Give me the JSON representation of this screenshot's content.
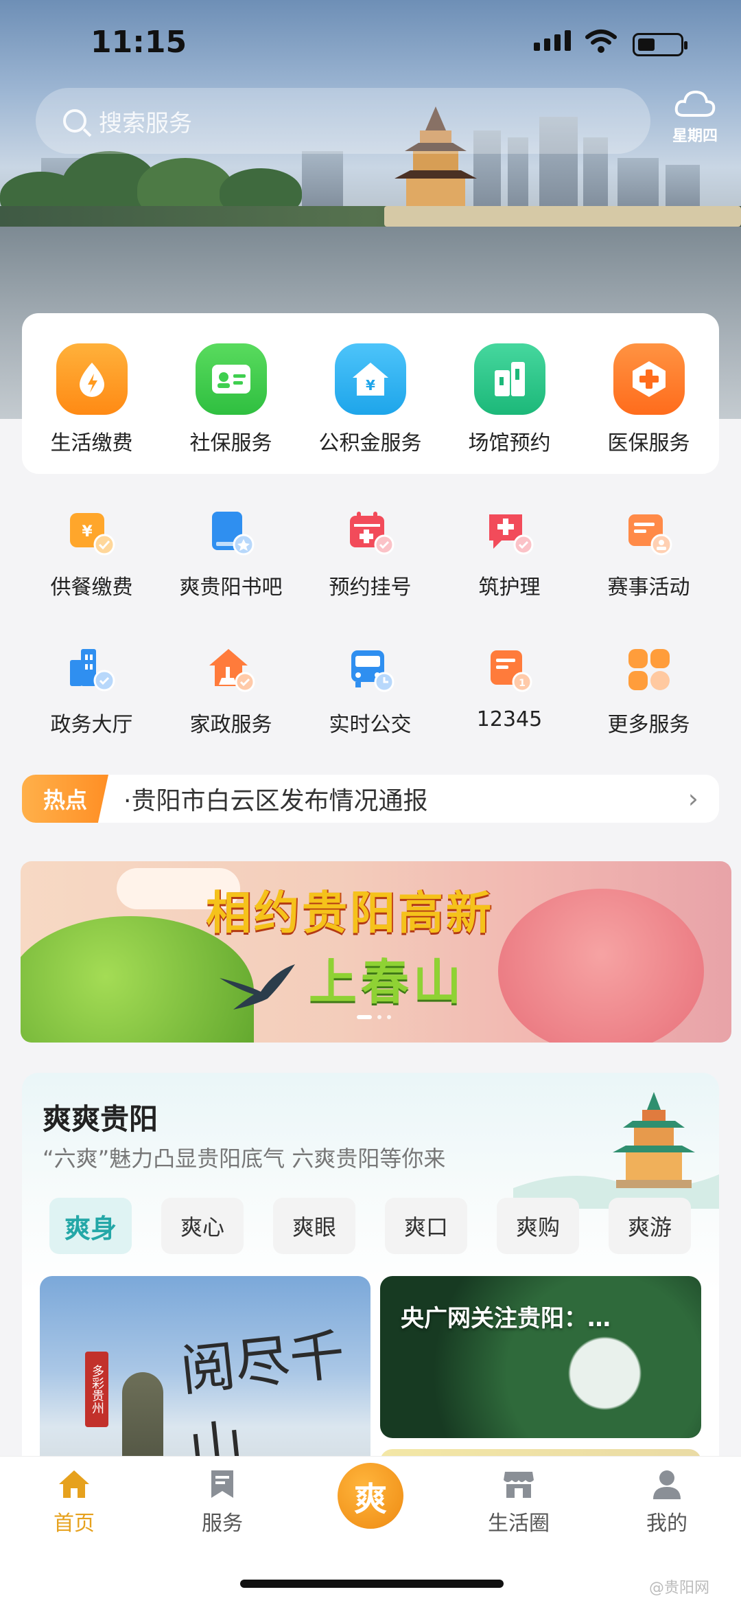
{
  "status": {
    "time": "11:15"
  },
  "search": {
    "placeholder": "搜索服务"
  },
  "weather": {
    "day": "星期四",
    "icon": "cloud-icon"
  },
  "top_services": [
    {
      "label": "生活缴费",
      "icon": "flame-bolt-icon",
      "color": "#ff9a1f"
    },
    {
      "label": "社保服务",
      "icon": "id-card-icon",
      "color": "#3fcf4f"
    },
    {
      "label": "公积金服务",
      "icon": "house-yuan-icon",
      "color": "#2fb3f0"
    },
    {
      "label": "场馆预约",
      "icon": "building-icon",
      "color": "#2dc58a"
    },
    {
      "label": "医保服务",
      "icon": "medical-cross-icon",
      "color": "#ff7a2a"
    }
  ],
  "services_row1": [
    {
      "label": "供餐缴费",
      "icon": "meal-payment-icon"
    },
    {
      "label": "爽贵阳书吧",
      "icon": "book-icon"
    },
    {
      "label": "预约挂号",
      "icon": "calendar-plus-icon"
    },
    {
      "label": "筑护理",
      "icon": "nursing-chat-icon"
    },
    {
      "label": "赛事活动",
      "icon": "event-card-icon"
    }
  ],
  "services_row2": [
    {
      "label": "政务大厅",
      "icon": "government-hall-icon"
    },
    {
      "label": "家政服务",
      "icon": "housekeeping-icon"
    },
    {
      "label": "实时公交",
      "icon": "bus-icon"
    },
    {
      "label": "12345",
      "icon": "hotline-icon"
    },
    {
      "label": "更多服务",
      "icon": "more-grid-icon"
    }
  ],
  "hot": {
    "tag": "热点",
    "text": "·贵阳市白云区发布情况通报"
  },
  "banner": {
    "line1": "相约贵阳高新",
    "line2": "上春山"
  },
  "shuang": {
    "title": "爽爽贵阳",
    "subtitle": "“六爽”魅力凸显贵阳底气 六爽贵阳等你来",
    "tabs": [
      "爽身",
      "爽心",
      "爽眼",
      "爽口",
      "爽购",
      "爽游"
    ],
    "card1": {
      "seal": "多彩贵州",
      "calligraphy": "阅尽千山"
    },
    "card2": {
      "caption": "央广网关注贵阳：…"
    }
  },
  "tabbar": [
    {
      "label": "首页",
      "icon": "home-icon"
    },
    {
      "label": "服务",
      "icon": "bookmark-icon"
    },
    {
      "label": "爽",
      "icon": "center-logo-icon"
    },
    {
      "label": "生活圈",
      "icon": "store-icon"
    },
    {
      "label": "我的",
      "icon": "user-icon"
    }
  ],
  "watermark": "@贵阳网",
  "colors": {
    "accent": "#e6a11d",
    "teal": "#24a7a7",
    "hot": "#ff8f25"
  }
}
